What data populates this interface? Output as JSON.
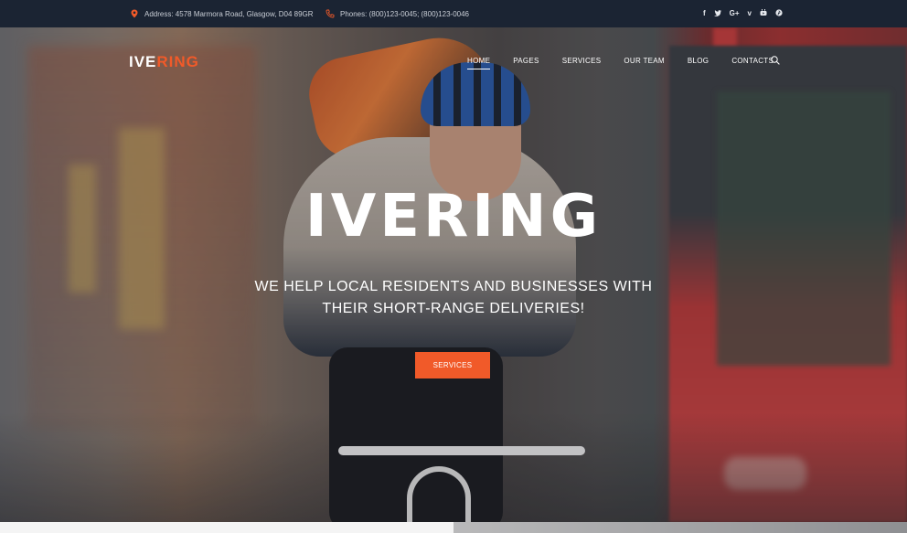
{
  "topbar": {
    "address": "Address: 4578 Marmora Road, Glasgow, D04 89GR",
    "phones": "Phones: (800)123-0045; (800)123-0046",
    "socials": [
      "f",
      "t",
      "G+",
      "v",
      "yt",
      "p"
    ]
  },
  "logo": {
    "part1": "IVE",
    "part2": "RING"
  },
  "nav": [
    "HOME",
    "PAGES",
    "SERVICES",
    "OUR TEAM",
    "BLOG",
    "CONTACTS"
  ],
  "hero": {
    "title": "IVERING",
    "subtitle_line1": "WE HELP LOCAL RESIDENTS AND BUSINESSES WITH",
    "subtitle_line2": "THEIR SHORT-RANGE DELIVERIES!",
    "button": "SERVICES"
  },
  "colors": {
    "accent": "#f15a29",
    "topbar": "#1b2433"
  }
}
